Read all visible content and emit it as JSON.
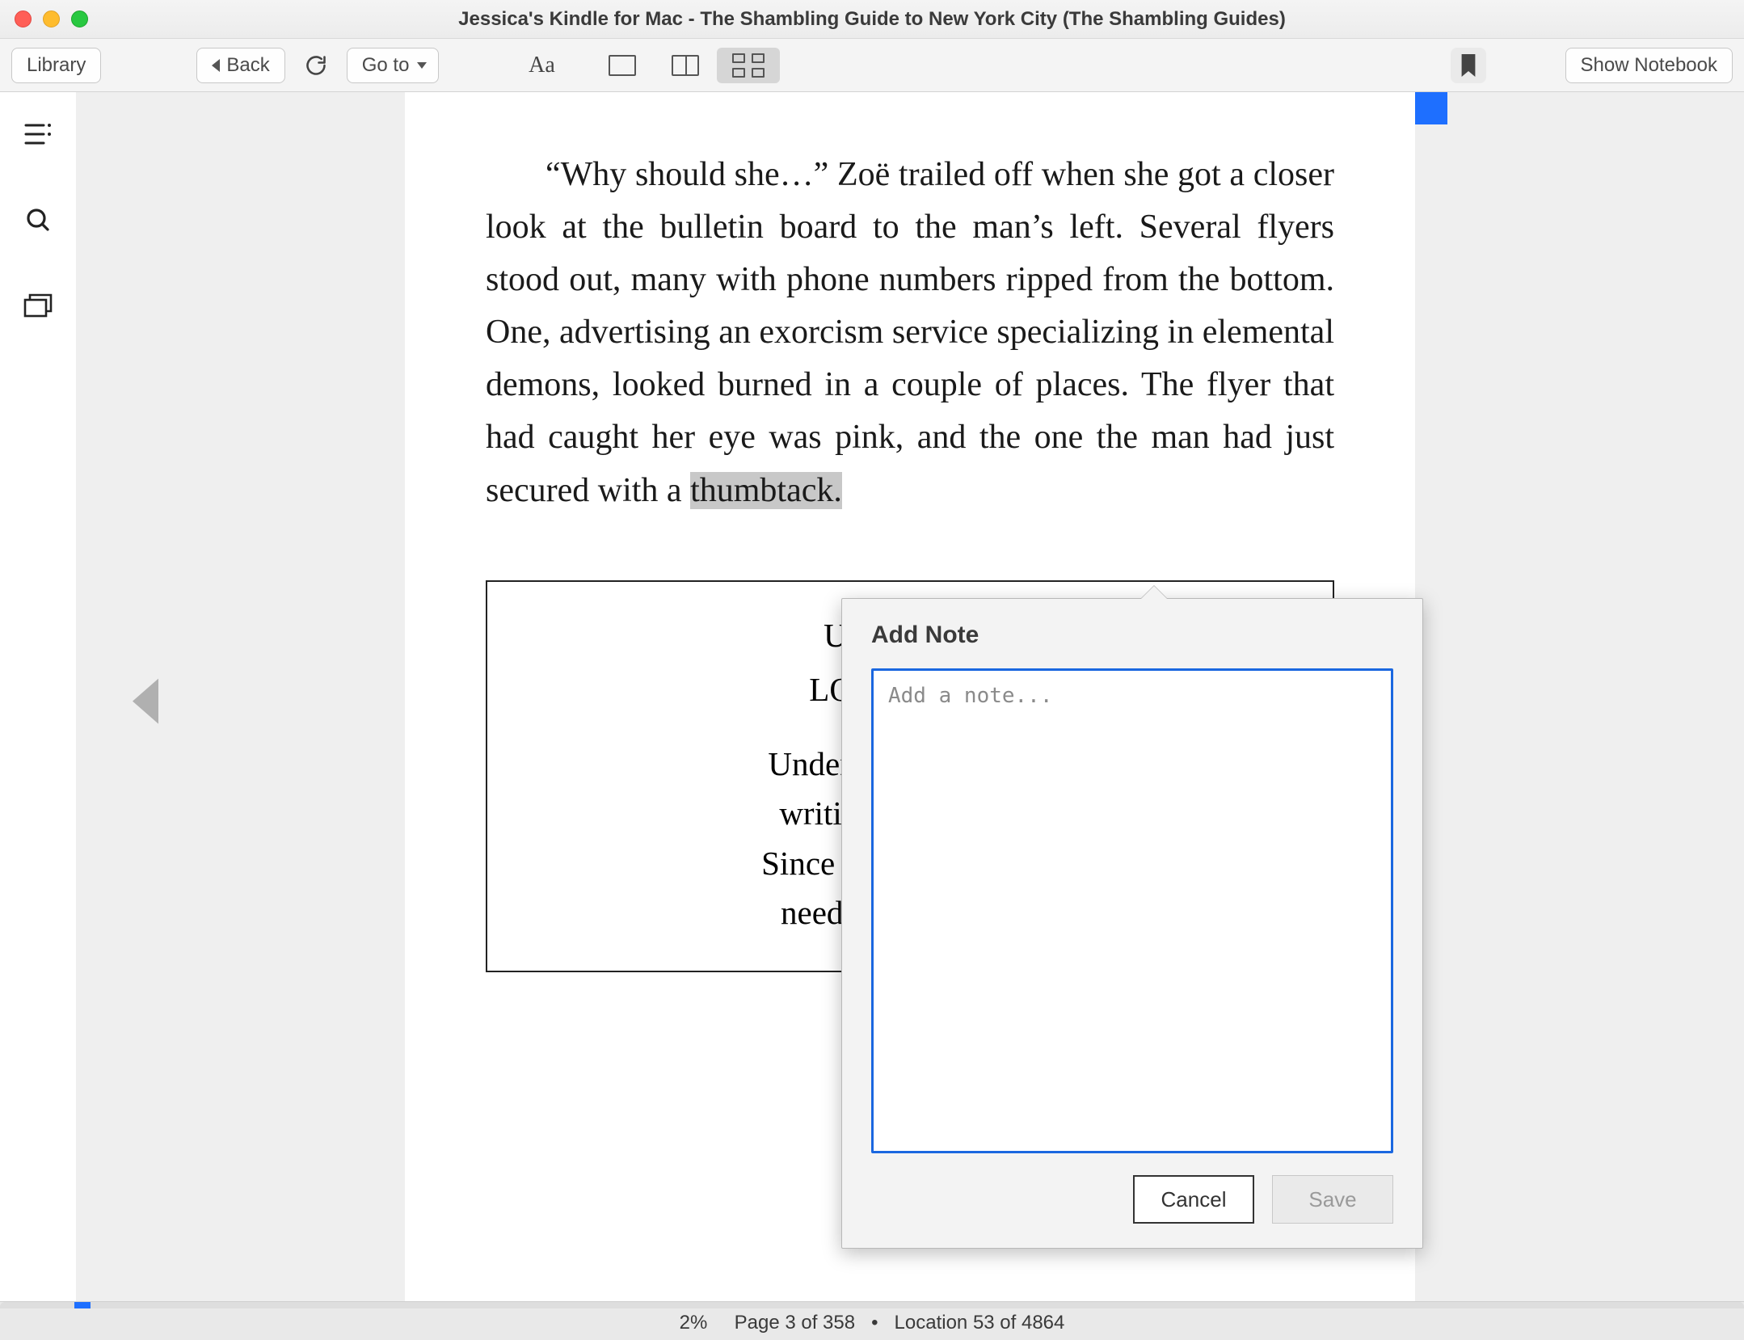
{
  "window": {
    "title": "Jessica's Kindle for Mac - The Shambling Guide to New York City (The Shambling Guides)"
  },
  "toolbar": {
    "library_label": "Library",
    "back_label": "Back",
    "goto_label": "Go to",
    "show_notebook_label": "Show Notebook"
  },
  "page": {
    "paragraph": "“Why should she…” Zoë trailed off when she got a closer look at the bulletin board to the man’s left. Several flyers stood out, many with phone numbers ripped from the bottom. One, advertis­ing an exorcism service specializing in elemental demons, looked burned in a couple of places. The flyer that had caught her eye was pink, and the one the man had just secured with a ",
    "highlighted": "thumbtack.",
    "flyer": {
      "line1": "Undergroun",
      "line2": "LOOKING F",
      "body": "Underground Publish\nwriting travel guide\nSince we’re writing fo\nneed people like y"
    }
  },
  "note_popover": {
    "title": "Add Note",
    "placeholder": "Add a note...",
    "cancel_label": "Cancel",
    "save_label": "Save"
  },
  "footer": {
    "percent": "2%",
    "page_text": "Page 3 of 358",
    "location_text": "Location 53 of 4864",
    "separator": "  •  "
  }
}
